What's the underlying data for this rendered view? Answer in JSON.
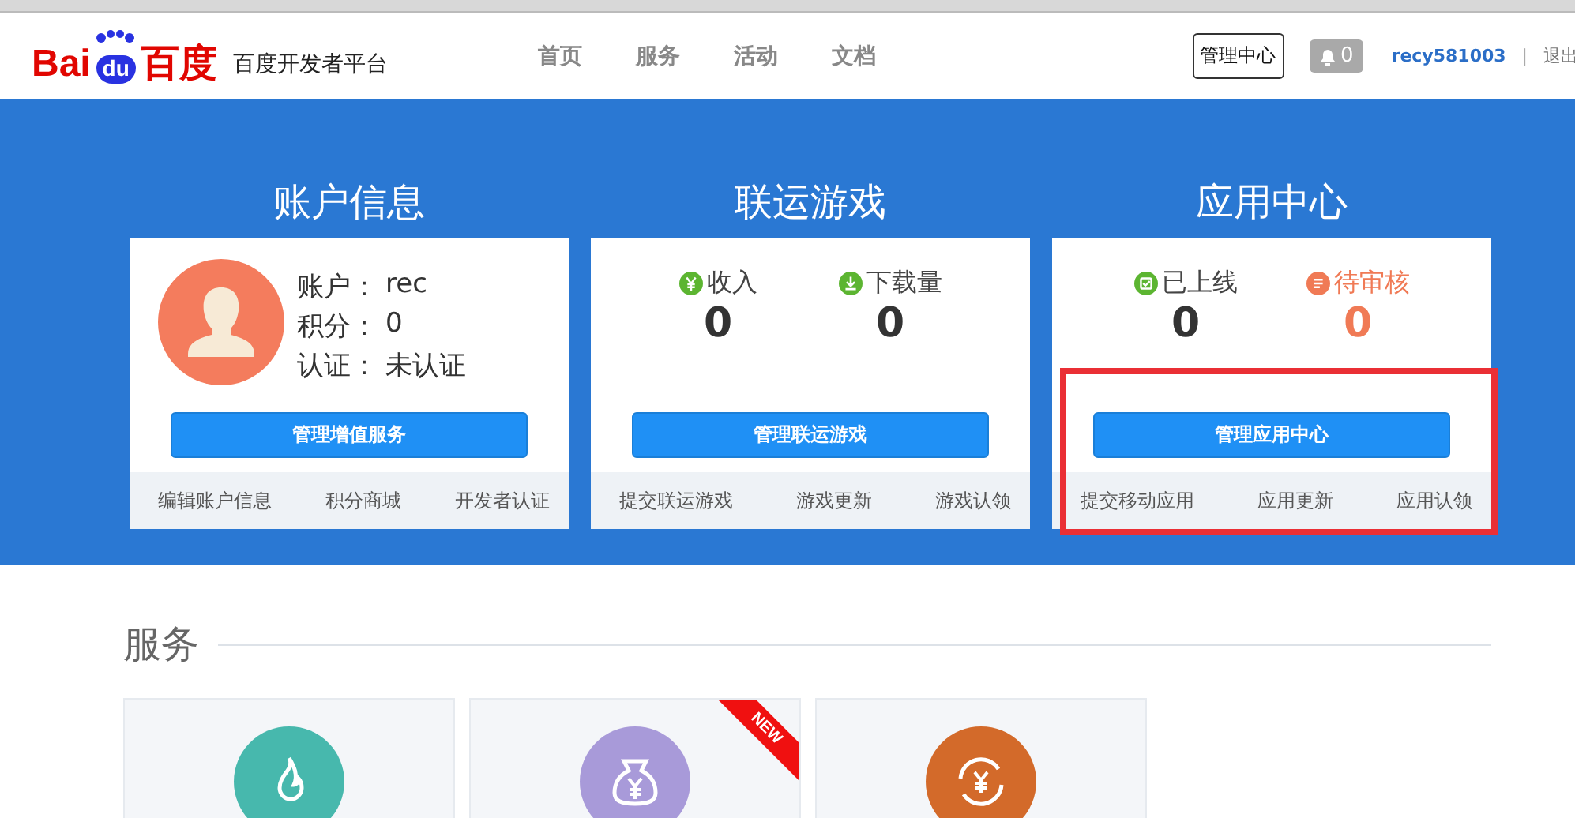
{
  "header": {
    "logo": {
      "part_1": "Bai",
      "part_2": "du",
      "part_3": "百度"
    },
    "site_name": "百度开发者平台",
    "nav": [
      {
        "label": "首页"
      },
      {
        "label": "服务"
      },
      {
        "label": "活动"
      },
      {
        "label": "文档"
      }
    ],
    "manage_button": "管理中心",
    "notifications": "0",
    "username": "recy581003",
    "separator": "|",
    "logout": "退出"
  },
  "cards": [
    {
      "kind": "account",
      "title": "账户信息",
      "highlighted": false,
      "fields": [
        {
          "label": "账户：",
          "value": "rec"
        },
        {
          "label": "积分：",
          "value": "0"
        },
        {
          "label": "认证：",
          "value": "未认证"
        }
      ],
      "button": "管理增值服务",
      "links": [
        "编辑账户信息",
        "积分商城",
        "开发者认证"
      ]
    },
    {
      "kind": "stats",
      "title": "联运游戏",
      "highlighted": false,
      "stats": [
        {
          "label": "收入",
          "value": "0",
          "color": "#333333"
        },
        {
          "label": "下载量",
          "value": "0",
          "color": "#333333"
        }
      ],
      "button": "管理联运游戏",
      "links": [
        "提交联运游戏",
        "游戏更新",
        "游戏认领"
      ]
    },
    {
      "kind": "stats",
      "title": "应用中心",
      "highlighted": true,
      "stats": [
        {
          "label": "已上线",
          "value": "0",
          "color": "#333333"
        },
        {
          "label": "待审核",
          "value": "0",
          "color": "#f07a55"
        }
      ],
      "button": "管理应用中心",
      "links": [
        "提交移动应用",
        "应用更新",
        "应用认领"
      ]
    }
  ],
  "services": {
    "title": "服务",
    "tiles": [
      {
        "color": "#47b8ad"
      },
      {
        "color": "#a89ad9",
        "badge": "NEW"
      },
      {
        "color": "#d36a2a"
      }
    ]
  }
}
